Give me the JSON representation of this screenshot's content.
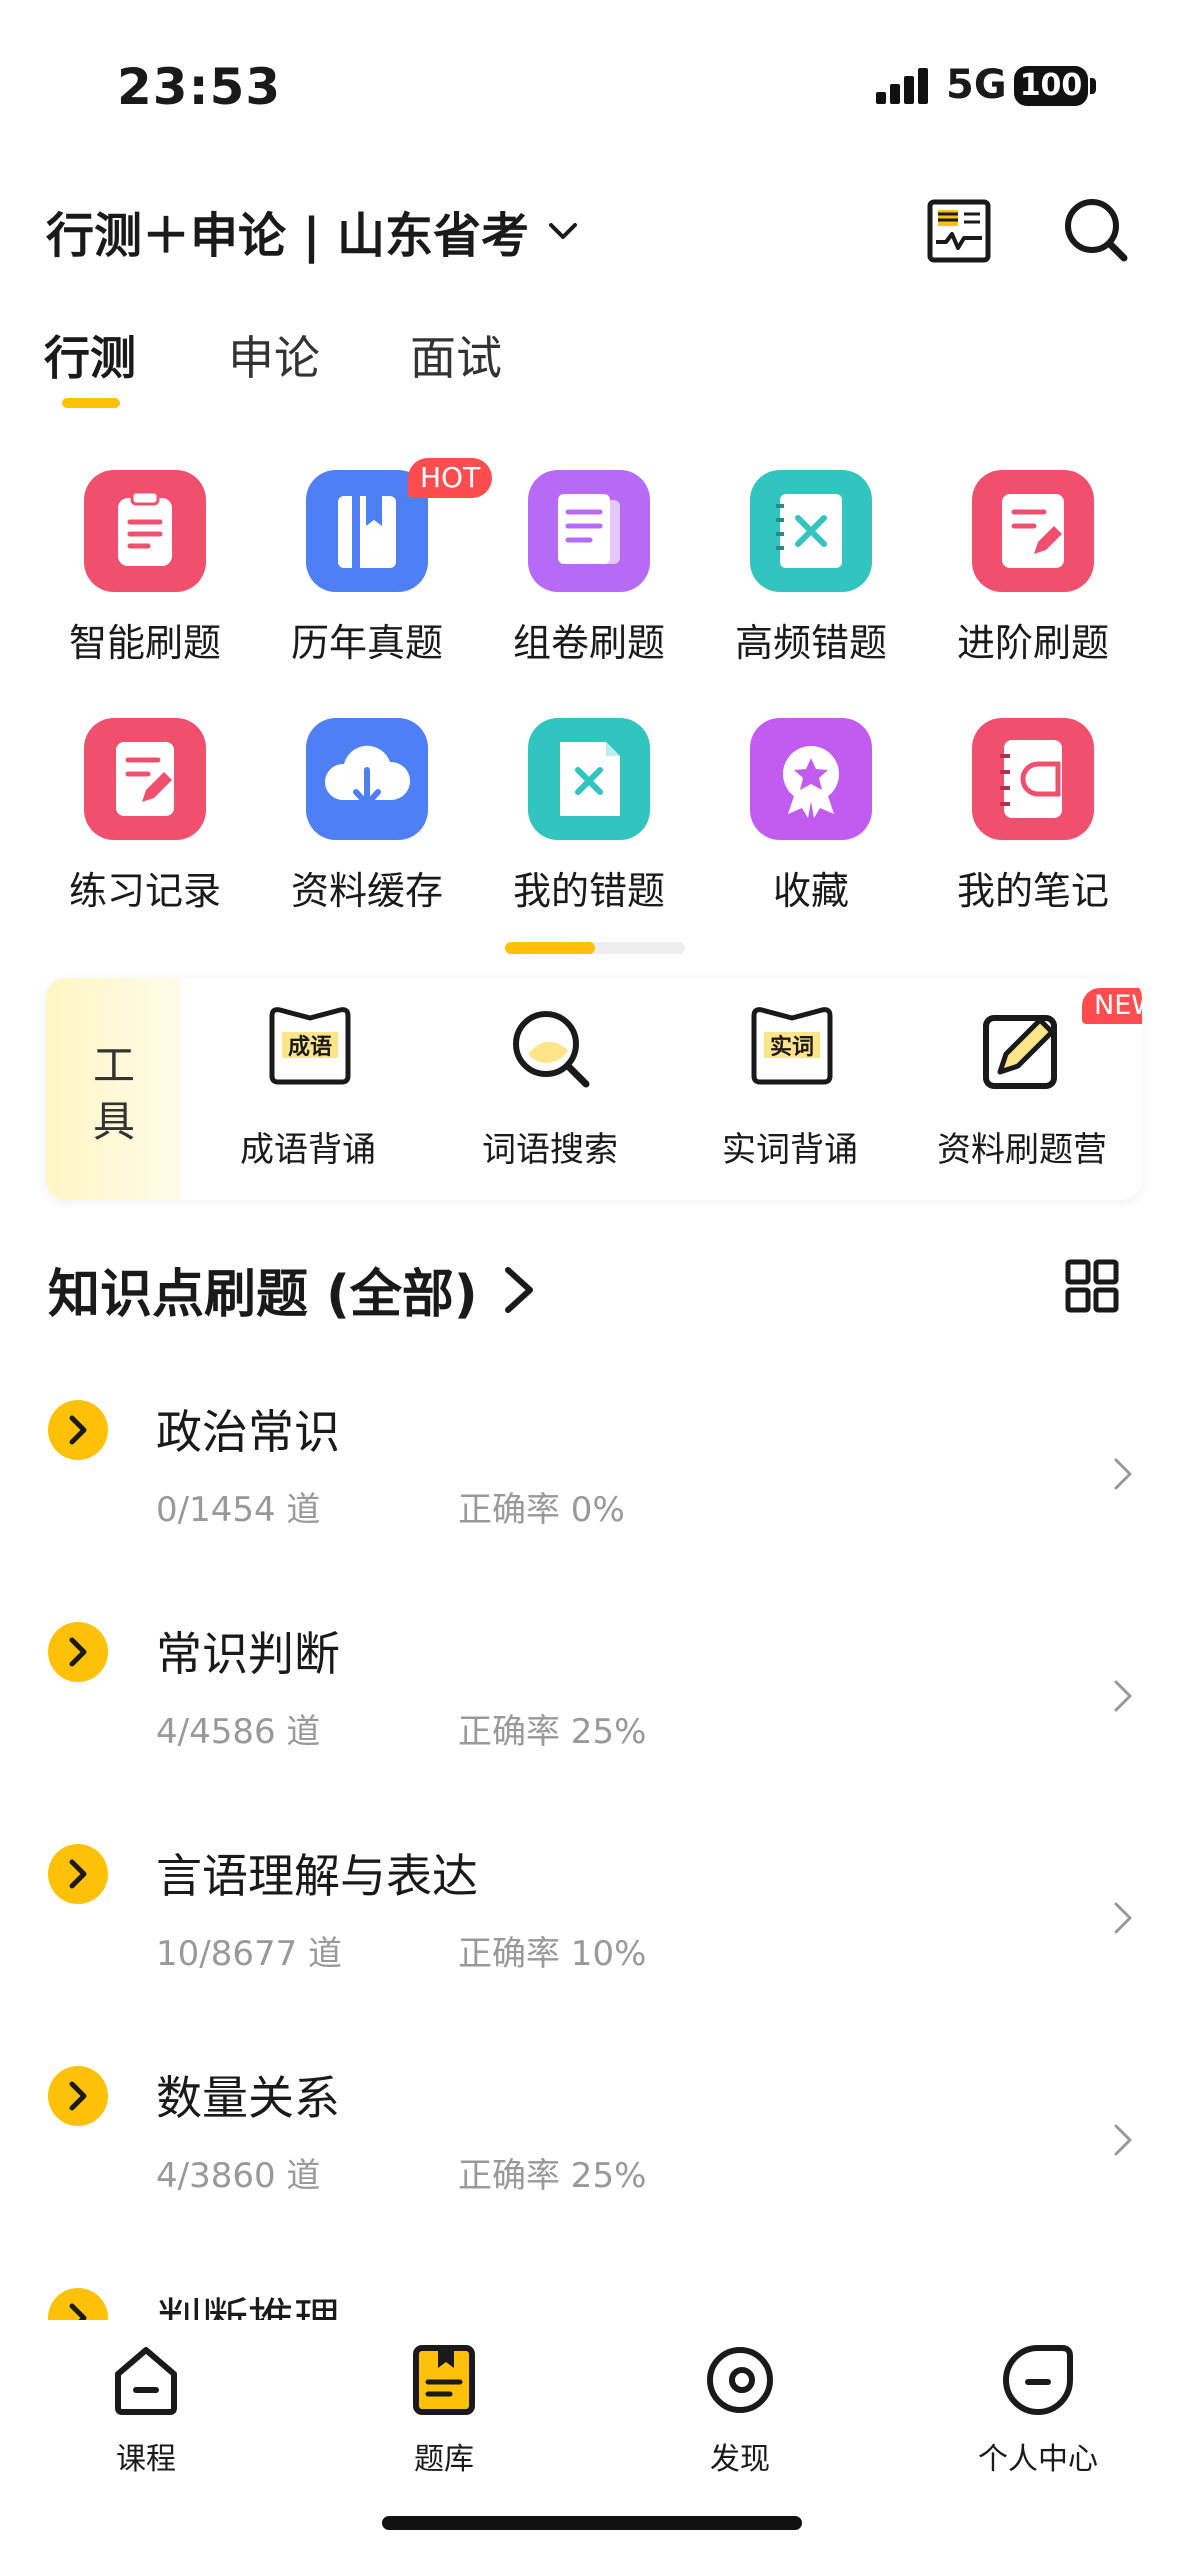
{
  "status_bar": {
    "time": "23:53",
    "network": "5G",
    "battery": "100"
  },
  "header": {
    "exam_title": "行测＋申论 | 山东省考"
  },
  "tabs": [
    {
      "label": "行测",
      "active": true
    },
    {
      "label": "申论",
      "active": false
    },
    {
      "label": "面试",
      "active": false
    }
  ],
  "features": [
    {
      "label": "智能刷题",
      "icon": "clipboard-icon",
      "color": "#f0506e"
    },
    {
      "label": "历年真题",
      "icon": "book-icon",
      "color": "#4f7ff5",
      "badge": "HOT"
    },
    {
      "label": "组卷刷题",
      "icon": "papers-icon",
      "color": "#b66af5"
    },
    {
      "label": "高频错题",
      "icon": "wrong-notebook-icon",
      "color": "#32c5c0"
    },
    {
      "label": "进阶刷题",
      "icon": "pen-paper-icon",
      "color": "#f0506e"
    },
    {
      "label": "练习记录",
      "icon": "edit-record-icon",
      "color": "#f0506e"
    },
    {
      "label": "资料缓存",
      "icon": "cloud-download-icon",
      "color": "#4f7ff5"
    },
    {
      "label": "我的错题",
      "icon": "wrong-paper-icon",
      "color": "#32c5c0"
    },
    {
      "label": "收藏",
      "icon": "award-icon",
      "color": "#c25cf0"
    },
    {
      "label": "我的笔记",
      "icon": "notebook-icon",
      "color": "#f0506e"
    }
  ],
  "pager": {
    "current_fraction": 0.5
  },
  "tools": {
    "label": [
      "工",
      "具"
    ],
    "items": [
      {
        "label": "成语背诵",
        "icon_text": "成语"
      },
      {
        "label": "词语搜索"
      },
      {
        "label": "实词背诵",
        "icon_text": "实词"
      },
      {
        "label": "资料刷题营",
        "badge": "NEW"
      }
    ]
  },
  "knowledge": {
    "title": "知识点刷题 (全部)",
    "items": [
      {
        "title": "政治常识",
        "count": "0/1454 道",
        "rate": "正确率 0%"
      },
      {
        "title": "常识判断",
        "count": "4/4586 道",
        "rate": "正确率 25%"
      },
      {
        "title": "言语理解与表达",
        "count": "10/8677 道",
        "rate": "正确率 10%"
      },
      {
        "title": "数量关系",
        "count": "4/3860 道",
        "rate": "正确率 25%"
      },
      {
        "title": "判断推理",
        "count": "",
        "rate": ""
      }
    ]
  },
  "bottom_nav": [
    {
      "label": "课程",
      "icon": "home-icon",
      "active": false
    },
    {
      "label": "题库",
      "icon": "question-bank-icon",
      "active": true
    },
    {
      "label": "发现",
      "icon": "discover-icon",
      "active": false
    },
    {
      "label": "个人中心",
      "icon": "profile-icon",
      "active": false
    }
  ],
  "colors": {
    "accent": "#ffc107",
    "badge_red": "#ff4d4f",
    "muted_text": "#999999"
  }
}
